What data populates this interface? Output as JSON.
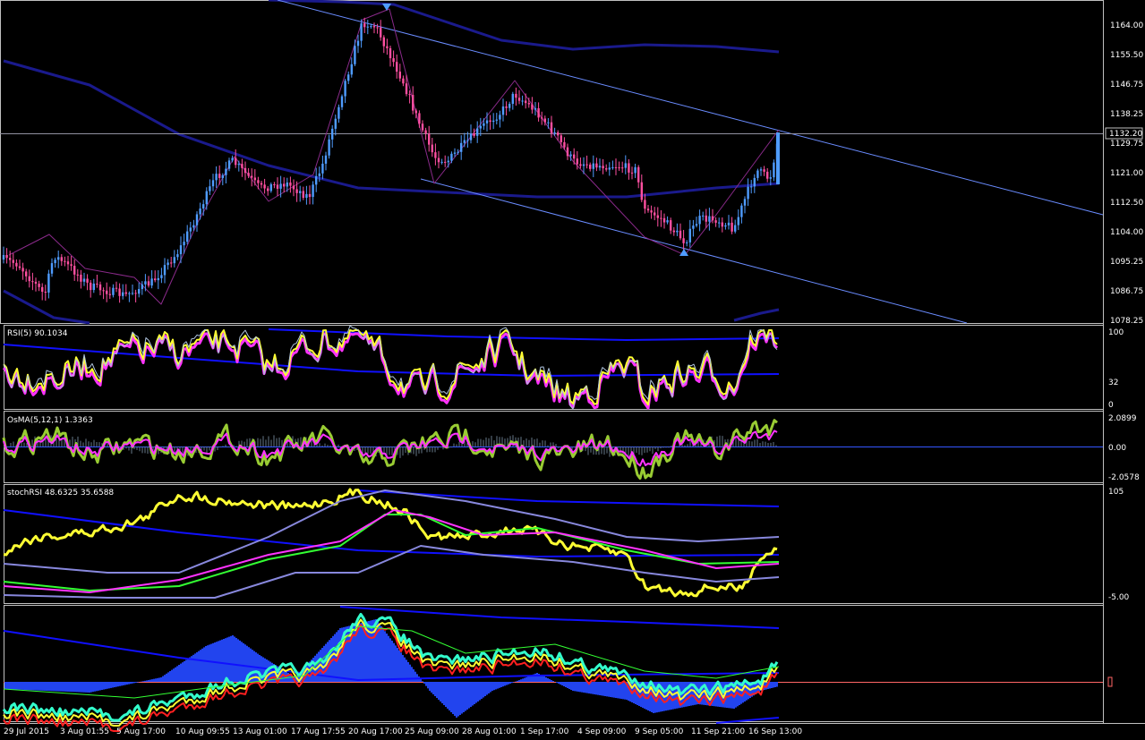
{
  "colors": {
    "background": "#000000",
    "frame": "#c0c0c0",
    "bull": "#4f9cff",
    "bear": "#ff4fa0",
    "channel": "#6a8cff",
    "ma_dark": "#1a1a8c",
    "ma_blue": "#1010ff",
    "yellow": "#ffff33",
    "magenta": "#ff33ff",
    "green": "#99cc33",
    "lime": "#33ff33",
    "cyan": "#33ffcc",
    "red": "#ff2020",
    "price_line": "#ff6666"
  },
  "price_axis": {
    "ticks": [
      "1164.00",
      "1155.50",
      "1146.75",
      "1138.25",
      "1129.75",
      "1121.00",
      "1112.50",
      "1104.00",
      "1095.25",
      "1086.75",
      "1078.25"
    ],
    "current_price": "1132.20"
  },
  "rsi_panel": {
    "label": "RSI(5) 90.1034",
    "ticks": [
      "100",
      "32",
      "0"
    ]
  },
  "osma_panel": {
    "label": "OsMA(5,12,1) 1.3363",
    "ticks": [
      "2.0899",
      "0.00",
      "-2.0578"
    ]
  },
  "stoch_panel": {
    "label": "stochRSI 48.6325 35.6588",
    "ticks": [
      "105",
      "-5.00"
    ]
  },
  "bottom_panel": {
    "label": ""
  },
  "time_axis": {
    "labels": [
      "29 Jul 2015",
      "3 Aug 01:55",
      "5 Aug 17:00",
      "10 Aug 09:55",
      "13 Aug 01:00",
      "17 Aug 17:55",
      "20 Aug 17:00",
      "25 Aug 09:00",
      "28 Aug 01:00",
      "1 Sep 17:00",
      "4 Sep 09:00",
      "9 Sep 05:00",
      "11 Sep 21:00",
      "16 Sep 13:00"
    ]
  }
}
